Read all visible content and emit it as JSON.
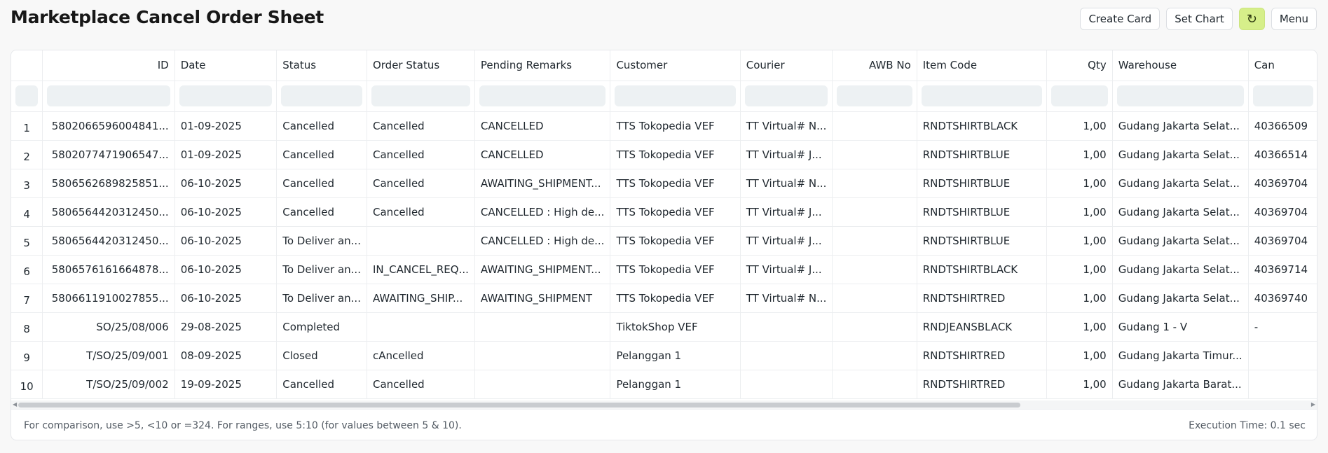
{
  "page": {
    "title": "Marketplace Cancel Order Sheet"
  },
  "toolbar": {
    "create_card": "Create Card",
    "set_chart": "Set Chart",
    "refresh_glyph": "↻",
    "menu": "Menu"
  },
  "table": {
    "columns": [
      "ID",
      "Date",
      "Status",
      "Order Status",
      "Pending Remarks",
      "Customer",
      "Courier",
      "AWB No",
      "Item Code",
      "Qty",
      "Warehouse",
      "Can"
    ],
    "rows": [
      [
        "1",
        "5802066596004841...",
        "01-09-2025",
        "Cancelled",
        "Cancelled",
        "CANCELLED",
        "TTS Tokopedia VEF",
        "TT Virtual# N...",
        "",
        "RNDTSHIRTBLACK",
        "1,00",
        "Gudang Jakarta Selat...",
        "40366509"
      ],
      [
        "2",
        "5802077471906547...",
        "01-09-2025",
        "Cancelled",
        "Cancelled",
        "CANCELLED",
        "TTS Tokopedia VEF",
        "TT Virtual# J...",
        "",
        "RNDTSHIRTBLUE",
        "1,00",
        "Gudang Jakarta Selat...",
        "40366514"
      ],
      [
        "3",
        "5806562689825851...",
        "06-10-2025",
        "Cancelled",
        "Cancelled",
        "AWAITING_SHIPMENT...",
        "TTS Tokopedia VEF",
        "TT Virtual# N...",
        "",
        "RNDTSHIRTBLUE",
        "1,00",
        "Gudang Jakarta Selat...",
        "40369704"
      ],
      [
        "4",
        "5806564420312450...",
        "06-10-2025",
        "Cancelled",
        "Cancelled",
        "CANCELLED : High de...",
        "TTS Tokopedia VEF",
        "TT Virtual# J...",
        "",
        "RNDTSHIRTBLUE",
        "1,00",
        "Gudang Jakarta Selat...",
        "40369704"
      ],
      [
        "5",
        "5806564420312450...",
        "06-10-2025",
        "To Deliver an...",
        "",
        "CANCELLED : High de...",
        "TTS Tokopedia VEF",
        "TT Virtual# J...",
        "",
        "RNDTSHIRTBLUE",
        "1,00",
        "Gudang Jakarta Selat...",
        "40369704"
      ],
      [
        "6",
        "5806576161664878...",
        "06-10-2025",
        "To Deliver an...",
        "IN_CANCEL_REQ...",
        "AWAITING_SHIPMENT...",
        "TTS Tokopedia VEF",
        "TT Virtual# J...",
        "",
        "RNDTSHIRTBLACK",
        "1,00",
        "Gudang Jakarta Selat...",
        "40369714"
      ],
      [
        "7",
        "5806611910027855...",
        "06-10-2025",
        "To Deliver an...",
        "AWAITING_SHIP...",
        "AWAITING_SHIPMENT",
        "TTS Tokopedia VEF",
        "TT Virtual# N...",
        "",
        "RNDTSHIRTRED",
        "1,00",
        "Gudang Jakarta Selat...",
        "40369740"
      ],
      [
        "8",
        "SO/25/08/006",
        "29-08-2025",
        "Completed",
        "",
        "",
        "TiktokShop VEF",
        "",
        "",
        "RNDJEANSBLACK",
        "1,00",
        "Gudang 1 - V",
        "-"
      ],
      [
        "9",
        "T/SO/25/09/001",
        "08-09-2025",
        "Closed",
        "cAncelled",
        "",
        "Pelanggan 1",
        "",
        "",
        "RNDTSHIRTRED",
        "1,00",
        "Gudang Jakarta Timur...",
        ""
      ],
      [
        "10",
        "T/SO/25/09/002",
        "19-09-2025",
        "Cancelled",
        "Cancelled",
        "",
        "Pelanggan 1",
        "",
        "",
        "RNDTSHIRTRED",
        "1,00",
        "Gudang Jakarta Barat...",
        ""
      ]
    ]
  },
  "footer": {
    "hint": "For comparison, use >5, <10 or =324. For ranges, use 5:10 (for values between 5 & 10).",
    "execution_time": "Execution Time: 0.1 sec"
  }
}
